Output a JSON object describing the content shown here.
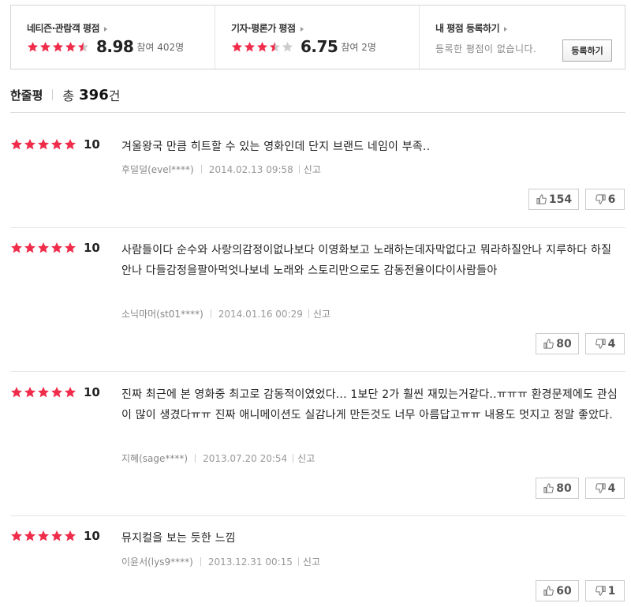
{
  "ratings": {
    "netizen": {
      "title": "네티즌·관람객 평점",
      "score": "8.98",
      "count": "참여 402명",
      "stars": [
        1,
        1,
        1,
        1,
        0.5
      ]
    },
    "critic": {
      "title": "기자·평론가 평점",
      "score": "6.75",
      "count": "참여 2명",
      "stars": [
        1,
        1,
        1,
        0.5,
        0
      ]
    },
    "mine": {
      "title": "내 평점 등록하기",
      "desc": "등록한 평점이 없습니다.",
      "button": "등록하기"
    }
  },
  "header": {
    "title": "한줄평",
    "total_label": "총",
    "total_num": "396",
    "total_unit": "건"
  },
  "colors": {
    "star_on": "#f02c4b",
    "star_off": "#cccccc"
  },
  "reviews": [
    {
      "score": "10",
      "text": "겨울왕국 만큼 히트할 수 있는 영화인데 단지 브랜드 네임이 부족..",
      "author": "후덜덜(evel****)",
      "date": "2014.02.13 09:58",
      "report": "신고",
      "likes": "154",
      "dislikes": "6"
    },
    {
      "score": "10",
      "text": "사람들이다 순수와 사랑의감정이없나보다 이영화보고 노래하는데자막없다고 뭐라하질안나 지루하다 하질안나 다들감정을팔아먹엇나보네 노래와 스토리만으로도 감동전율이다이사람들아",
      "author": "소닉마머(st01****)",
      "date": "2014.01.16 00:29",
      "report": "신고",
      "likes": "80",
      "dislikes": "4"
    },
    {
      "score": "10",
      "text": "진짜 최근에 본 영화중 최고로 감동적이였었다... 1보단 2가 훨씬 재밌는거같다..ㅠㅠㅠ 환경문제에도 관심이 많이 생겼다ㅠㅠ 진짜 애니메이션도 실감나게 만든것도 너무 아름답고ㅠㅠ 내용도 멋지고 정말 좋았다.",
      "author": "지혜(sage****)",
      "date": "2013.07.20 20:54",
      "report": "신고",
      "likes": "80",
      "dislikes": "4"
    },
    {
      "score": "10",
      "text": "뮤지컬을 보는 듯한 느낌",
      "author": "이윤서(lys9****)",
      "date": "2013.12.31 00:15",
      "report": "신고",
      "likes": "60",
      "dislikes": "1"
    }
  ]
}
